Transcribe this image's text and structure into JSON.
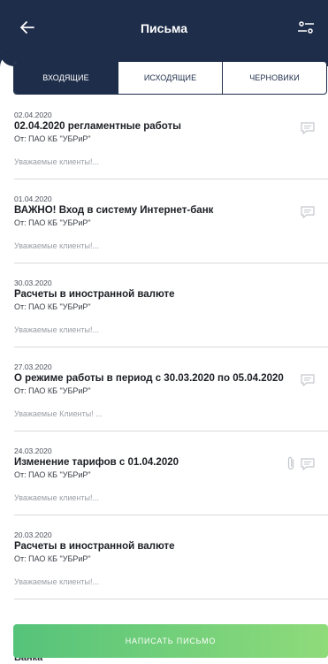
{
  "header": {
    "title": "Письма"
  },
  "tabs": [
    {
      "label": "ВХОДЯЩИЕ",
      "active": true
    },
    {
      "label": "ИСХОДЯЩИЕ",
      "active": false
    },
    {
      "label": "ЧЕРНОВИКИ",
      "active": false
    }
  ],
  "messages": [
    {
      "date": "02.04.2020",
      "title": "02.04.2020 регламентные работы",
      "from": "От: ПАО КБ \"УБРиР\"",
      "preview": "Уважаемые клиенты!...",
      "attachment": false,
      "icon": "message-icon"
    },
    {
      "date": "01.04.2020",
      "title": "ВАЖНО! Вход в систему Интернет-банк",
      "from": "От: ПАО КБ \"УБРиР\"",
      "preview": "Уважаемые клиенты!...",
      "attachment": false,
      "icon": "message-icon"
    },
    {
      "date": "30.03.2020",
      "title": "Расчеты в иностранной валюте",
      "from": "От: ПАО КБ \"УБРиР\"",
      "preview": "Уважаемые клиенты!...",
      "attachment": false,
      "icon": "none"
    },
    {
      "date": "27.03.2020",
      "title": "О режиме работы в период с 30.03.2020 по 05.04.2020",
      "from": "От: ПАО КБ \"УБРиР\"",
      "preview": "Уважаемые Клиенты! ...",
      "attachment": false,
      "icon": "message-icon"
    },
    {
      "date": "24.03.2020",
      "title": "Изменение тарифов с 01.04.2020",
      "from": "От: ПАО КБ \"УБРиР\"",
      "preview": "Уважаемые клиенты!...",
      "attachment": true,
      "icon": "message-icon"
    },
    {
      "date": "20.03.2020",
      "title": "Расчеты в иностранной валюте",
      "from": "От: ПАО КБ \"УБРиР\"",
      "preview": "Уважаемые клиенты!...",
      "attachment": false,
      "icon": "none"
    }
  ],
  "bottom_text": "Банка",
  "write_button": {
    "label": "НАПИСАТЬ ПИСЬМО"
  },
  "colors": {
    "header_bg": "#1e2d4a",
    "button_gradient_start": "#55c37a",
    "button_gradient_end": "#8fdb7a"
  }
}
